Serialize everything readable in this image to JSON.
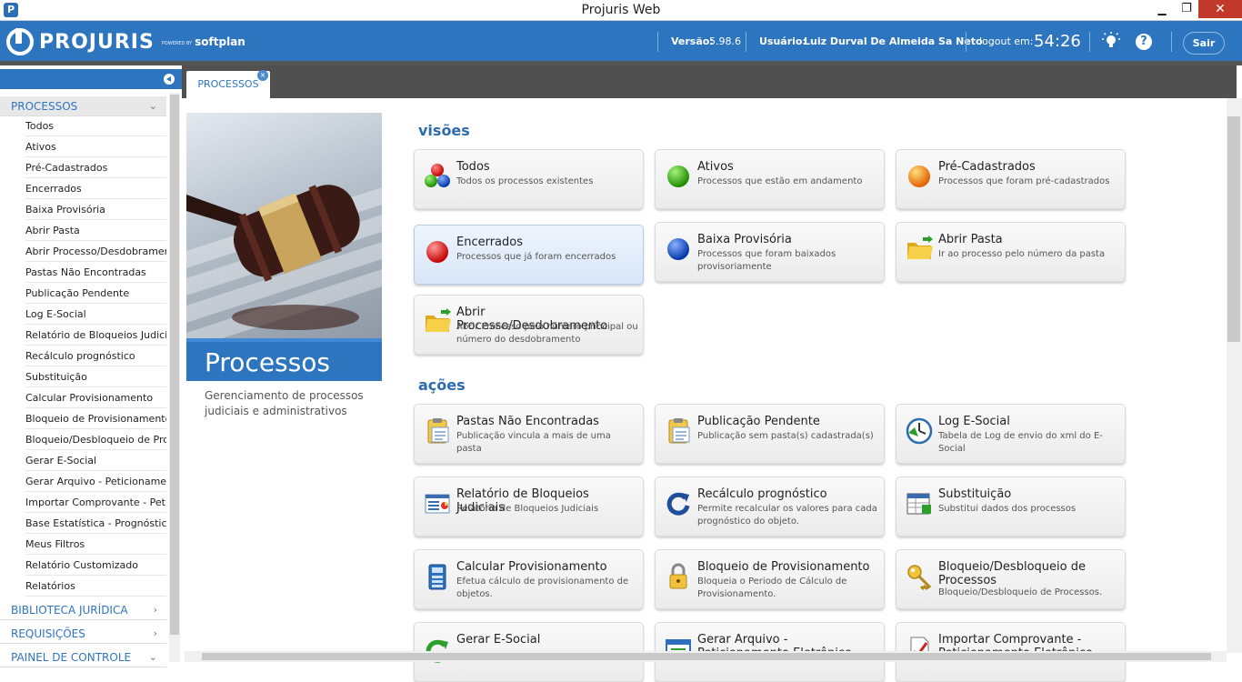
{
  "window": {
    "title": "Projuris Web",
    "app_icon": "P"
  },
  "header": {
    "logo": "PROJURIS",
    "powered_by": "POWERED BY",
    "softplan": "softplan",
    "version_label": "Versão:",
    "version": "5.98.6",
    "user_label": "Usuário:",
    "user": "Luiz Durval De Almeida Sa Neto",
    "logout_label": "logout em:",
    "timer": "54:26",
    "sair": "Sair",
    "accent": "#2e75c0"
  },
  "sidebar": {
    "sections": [
      {
        "label": "PROCESSOS",
        "chevron": "⌄"
      },
      {
        "label": "BIBLIOTECA JURÍDICA",
        "chevron": "›"
      },
      {
        "label": "REQUISIÇÕES",
        "chevron": "›"
      },
      {
        "label": "PAINEL DE CONTROLE",
        "chevron": "⌄"
      }
    ],
    "items": [
      "Todos",
      "Ativos",
      "Pré-Cadastrados",
      "Encerrados",
      "Baixa Provisória",
      "Abrir Pasta",
      "Abrir Processo/Desdobramento",
      "Pastas Não Encontradas",
      "Publicação Pendente",
      "Log E-Social",
      "Relatório de Bloqueios Judiciais",
      "Recálculo prognóstico",
      "Substituição",
      "Calcular Provisionamento",
      "Bloqueio de Provisionamento",
      "Bloqueio/Desbloqueio de Processos",
      "Gerar E-Social",
      "Gerar Arquivo - Peticionamento Eletrônico",
      "Importar Comprovante - Peticionamento Eletrônico",
      "Base Estatística - Prognóstico Inteligente",
      "Meus Filtros",
      "Relatório Customizado",
      "Relatórios"
    ]
  },
  "tab": {
    "label": "PROCESSOS",
    "close": "×"
  },
  "hero": {
    "title": "Processos",
    "description": "Gerenciamento de processos judiciais e administrativos"
  },
  "visoes": {
    "heading": "visões",
    "cards": [
      {
        "title": "Todos",
        "desc": "Todos os processos existentes",
        "icon": "three-balls-icon"
      },
      {
        "title": "Ativos",
        "desc": "Processos que estão em andamento",
        "icon": "green-ball-icon"
      },
      {
        "title": "Pré-Cadastrados",
        "desc": "Processos que foram pré-cadastrados",
        "icon": "orange-ball-icon"
      },
      {
        "title": "Encerrados",
        "desc": "Processos que já foram encerrados",
        "icon": "red-ball-icon"
      },
      {
        "title": "Baixa Provisória",
        "desc": "Processos que foram baixados provisoriamente",
        "icon": "blue-ball-icon"
      },
      {
        "title": "Abrir Pasta",
        "desc": "Ir ao processo pelo número da pasta",
        "icon": "folder-icon"
      },
      {
        "title": "Abrir Processo/Desdobramento",
        "desc": "Abrir Processo pelo número principal ou número do desdobramento",
        "icon": "folder-icon"
      }
    ]
  },
  "acoes": {
    "heading": "ações",
    "cards": [
      {
        "title": "Pastas Não Encontradas",
        "desc": "Publicação vincula a mais de uma pasta",
        "icon": "clipboard-icon"
      },
      {
        "title": "Publicação Pendente",
        "desc": "Publicação sem pasta(s) cadastrada(s)",
        "icon": "clipboard-icon"
      },
      {
        "title": "Log E-Social",
        "desc": "Tabela de Log de envio do xml do E-Social",
        "icon": "clock-icon"
      },
      {
        "title": "Relatório de Bloqueios Judiciais",
        "desc": "Relatório de Bloqueios Judiciais",
        "icon": "report-icon"
      },
      {
        "title": "Recálculo prognóstico",
        "desc": "Permite recalcular os valores para cada prognóstico do objeto.",
        "icon": "refresh-icon"
      },
      {
        "title": "Substituição",
        "desc": "Substitui dados dos processos",
        "icon": "table-icon"
      },
      {
        "title": "Calcular Provisionamento",
        "desc": "Efetua cálculo de provisionamento de objetos.",
        "icon": "calculator-icon"
      },
      {
        "title": "Bloqueio de Provisionamento",
        "desc": "Bloqueia o Periodo de Cálculo de Provisionamento.",
        "icon": "lock-icon"
      },
      {
        "title": "Bloqueio/Desbloqueio de Processos",
        "desc": "Bloqueio/Desbloqueio de Processos.",
        "icon": "key-icon"
      },
      {
        "title": "Gerar E-Social",
        "desc": "",
        "icon": "refresh-green-icon"
      },
      {
        "title": "Gerar Arquivo - Peticionamento Eletrônico",
        "desc": "",
        "icon": "window-icon"
      },
      {
        "title": "Importar Comprovante - Peticionamento Eletrônico",
        "desc": "",
        "icon": "document-check-icon"
      }
    ]
  }
}
